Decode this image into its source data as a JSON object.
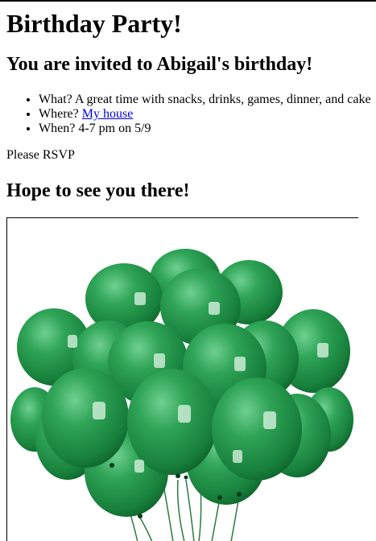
{
  "page": {
    "title": "Birthday Party!",
    "invite_heading": "You are invited to Abigail's birthday!",
    "details": [
      {
        "prefix": "What? ",
        "text": "A great time with snacks, drinks, games, dinner, and cake"
      },
      {
        "prefix": "Where? ",
        "link_text": "My house"
      },
      {
        "prefix": "When? ",
        "text": "4-7 pm on 5/9"
      }
    ],
    "rsvp": "Please RSVP",
    "closing_heading": "Hope to see you there!"
  },
  "image": {
    "subject": "green balloons bunch",
    "balloon_color": "#1f8f45",
    "balloon_dark": "#0f6a2e",
    "string_color": "#2c7a3c"
  },
  "colors": {
    "link": "#0000ee",
    "text": "#000000",
    "background": "#ffffff"
  }
}
